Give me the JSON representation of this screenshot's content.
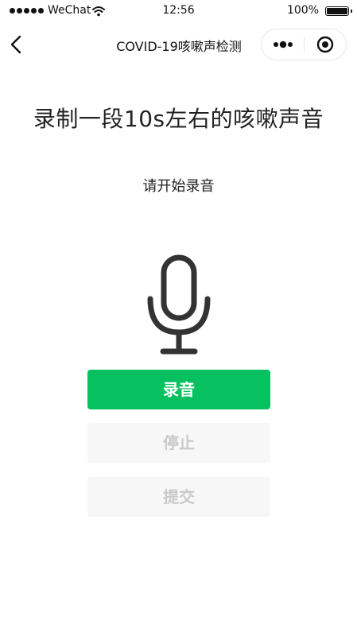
{
  "status_bar": {
    "carrier": "WeChat",
    "time": "12:56",
    "battery": "100%"
  },
  "nav": {
    "title": "COVID-19咳嗽声检测",
    "back_icon": "chevron-left-icon",
    "more_icon": "more-dots-icon",
    "close_icon": "target-close-icon"
  },
  "main": {
    "heading": "录制一段10s左右的咳嗽声音",
    "status": "请开始录音",
    "mic_icon": "microphone-icon"
  },
  "buttons": {
    "record": "录音",
    "stop": "停止",
    "submit": "提交"
  },
  "colors": {
    "accent": "#07c160",
    "disabled_bg": "#f7f7f7",
    "disabled_text": "#c9c9c9"
  }
}
